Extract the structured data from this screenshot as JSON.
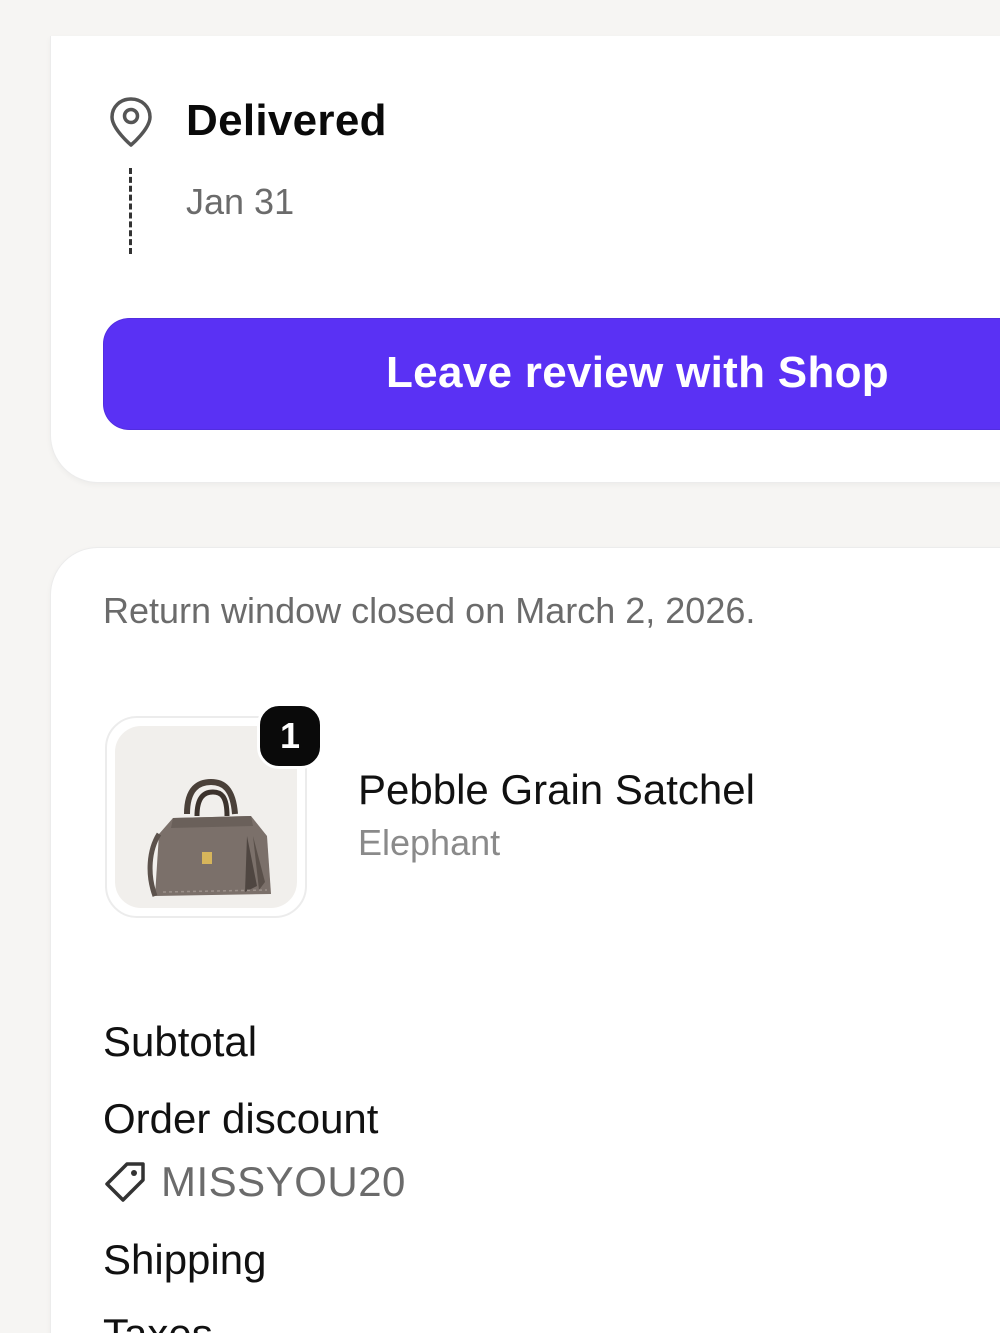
{
  "delivery": {
    "status": "Delivered",
    "date": "Jan 31",
    "icon": "location-pin-icon"
  },
  "review": {
    "button_label": "Leave review with Shop",
    "accent_color": "#5a31f4"
  },
  "order": {
    "return_note": "Return window closed on March 2, 2026.",
    "items": [
      {
        "name": "Pebble Grain Satchel",
        "variant": "Elephant",
        "quantity": "1",
        "image": "satchel-bag-image"
      }
    ],
    "summary": {
      "subtotal_label": "Subtotal",
      "discount_label": "Order discount",
      "discount_code": "MISSYOU20",
      "discount_icon": "tag-icon",
      "shipping_label": "Shipping",
      "taxes_label": "Taxes"
    }
  }
}
